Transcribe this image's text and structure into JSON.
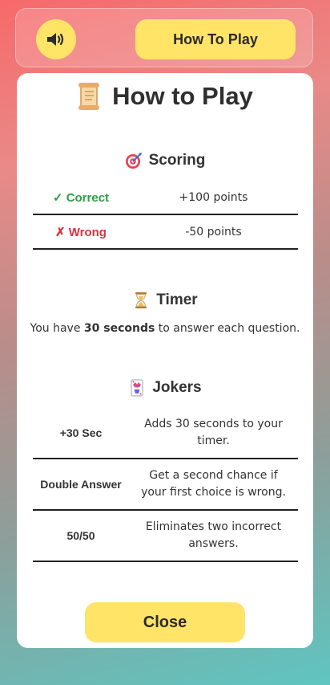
{
  "header": {
    "sound_icon": "speaker-volume-icon",
    "how_to_play_label": "How To Play"
  },
  "modal": {
    "title": "How to Play",
    "title_icon": "scroll-icon",
    "scoring": {
      "heading": "Scoring",
      "icon": "target-icon",
      "rows": [
        {
          "label": "✓ Correct",
          "value": "+100 points",
          "color": "#2e9e46"
        },
        {
          "label": "✗ Wrong",
          "value": "-50 points",
          "color": "#d8313f"
        }
      ]
    },
    "timer": {
      "heading": "Timer",
      "icon": "hourglass-icon",
      "text_before": "You have ",
      "text_bold": "30 seconds",
      "text_after": " to answer each question."
    },
    "jokers": {
      "heading": "Jokers",
      "icon": "joker-card-icon",
      "rows": [
        {
          "name": "+30 Sec",
          "description": "Adds 30 seconds to your timer."
        },
        {
          "name": "Double Answer",
          "description": "Get a second chance if your first choice is wrong."
        },
        {
          "name": "50/50",
          "description": "Eliminates two incorrect answers."
        }
      ]
    },
    "close_label": "Close"
  },
  "colors": {
    "accent_yellow": "#ffe468",
    "correct_green": "#2e9e46",
    "wrong_red": "#d8313f"
  }
}
